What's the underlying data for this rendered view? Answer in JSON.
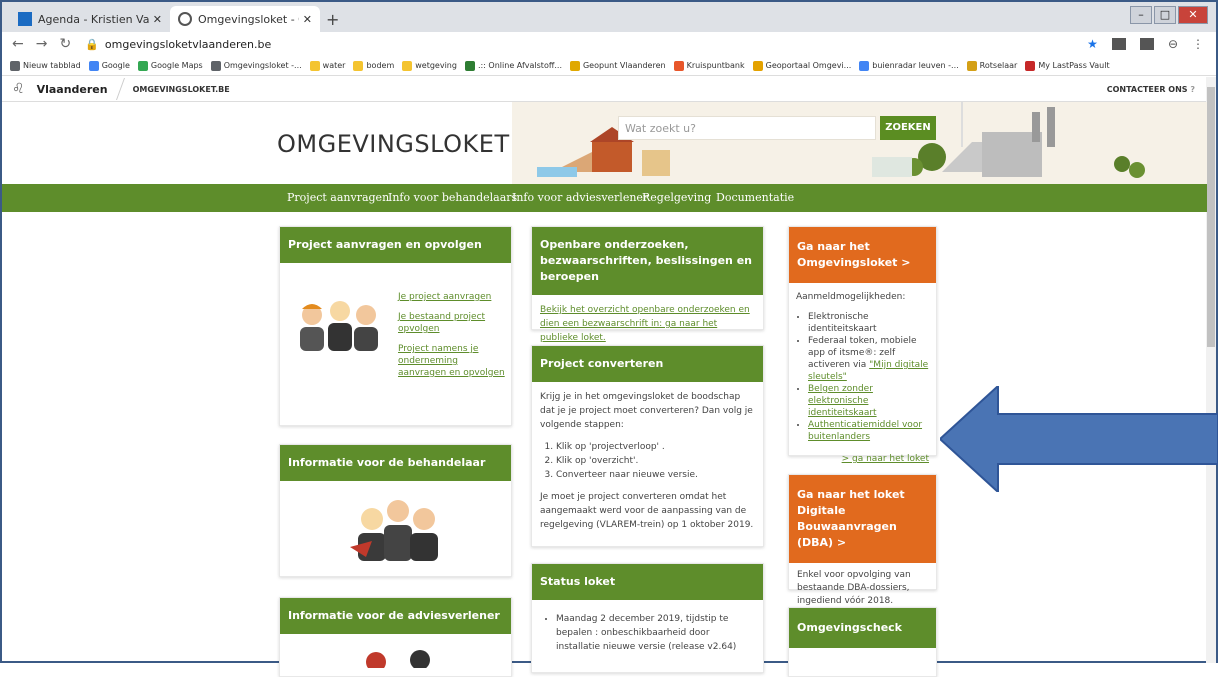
{
  "browser": {
    "tabs": [
      {
        "title": "Agenda - Kristien Vandenbempt"
      },
      {
        "title": "Omgevingsloket - Omgevingslo..."
      }
    ],
    "url": "omgevingsloketvlaanderen.be",
    "bookmarks": [
      "Nieuw tabblad",
      "Google",
      "Google Maps",
      "Omgevingsloket -...",
      "water",
      "bodem",
      "wetgeving",
      ".:: Online Afvalstoff...",
      "Geopunt Vlaanderen",
      "Kruispuntbank",
      "Geoportaal Omgevi...",
      "buienradar leuven -...",
      "Rotselaar",
      "My LastPass Vault"
    ]
  },
  "site": {
    "brand": "Vlaanderen",
    "subsite": "OMGEVINGSLOKET.BE",
    "contact": "CONTACTEER ONS",
    "logo": "OMGEVINGSLOKET",
    "search_placeholder": "Wat zoekt u?",
    "search_button": "ZOEKEN",
    "menu": [
      "Project aanvragen",
      "Info voor behandelaars",
      "Info voor adviesverlener",
      "Regelgeving",
      "Documentatie"
    ]
  },
  "col1": {
    "card1_title": "Project aanvragen en opvolgen",
    "links": [
      "Je project aanvragen",
      "Je bestaand project opvolgen",
      "Project namens je onderneming aanvragen en opvolgen"
    ],
    "card2_title": "Informatie voor de behandelaar",
    "card3_title": "Informatie voor de adviesverlener"
  },
  "col2": {
    "card1_title": "Openbare onderzoeken, bezwaarschriften, beslissingen en beroepen",
    "card1_link": "Bekijk het overzicht openbare onderzoeken en dien een bezwaarschrift in: ga naar het publieke loket.",
    "card2_title": "Project converteren",
    "card2_intro": "Krijg je in het omgevingsloket de boodschap dat je je project moet converteren? Dan volg je volgende stappen:",
    "steps": [
      "Klik op 'projectverloop' .",
      "Klik op 'overzicht'.",
      "Converteer naar nieuwe versie."
    ],
    "card2_outro": "Je moet je project converteren omdat het aangemaakt werd voor de aanpassing van de regelgeving (VLAREM-trein) op 1 oktober 2019.",
    "card3_title": "Status loket",
    "status": "Maandag 2 december 2019, tijdstip te bepalen : onbeschikbaarheid door installatie nieuwe versie (release v2.64)"
  },
  "col3": {
    "card1_title": "Ga naar het Omgevingsloket >",
    "login_intro": "Aanmeldmogelijkheden:",
    "login_items": [
      "Elektronische identiteitskaart",
      "Federaal token, mobiele app of itsme®: zelf activeren via "
    ],
    "login_link1": "\"Mijn digitale sleutels\"",
    "login_links": [
      "Belgen zonder elektronische identiteitskaart",
      "Authenticatiemiddel voor buitenlanders"
    ],
    "loket_link": "> ga naar het loket",
    "card2_title": "Ga naar het loket Digitale Bouwaanvragen (DBA) >",
    "card2_text": "Enkel voor opvolging van bestaande DBA-dossiers, ingediend vóór 2018.",
    "card3_title": "Omgevingscheck"
  },
  "colors": {
    "green": "#5e8d2b",
    "orange": "#e16a1e",
    "arrow": "#4a74b4"
  }
}
